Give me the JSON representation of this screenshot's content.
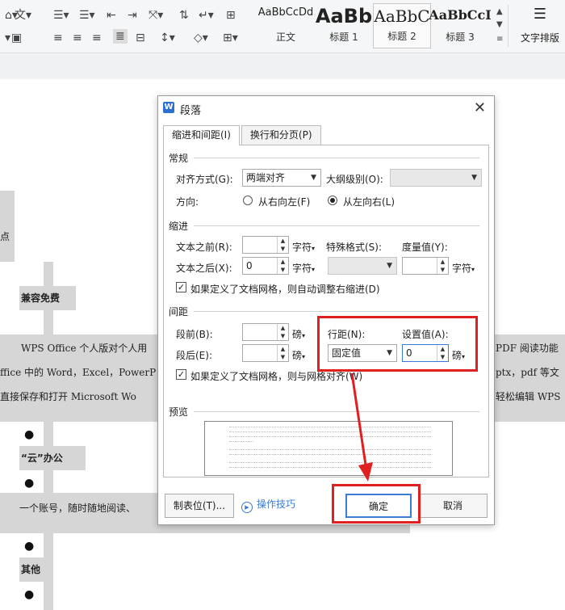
{
  "ribbon": {
    "styles": [
      {
        "sample": "AaBbCcDd",
        "name": "正文"
      },
      {
        "sample": "AaBb",
        "name": "标题 1"
      },
      {
        "sample": "AaBbC",
        "name": "标题 2"
      },
      {
        "sample": "AaBbCcI",
        "name": "标题 3"
      }
    ],
    "layout_label": "文字排版"
  },
  "document": {
    "frag_dian": "点",
    "heading1": "兼容免费",
    "para1": "WPS Office 个人版对个人用",
    "para1_right": "PDF 阅读功能",
    "para2": "ffice 中的 Word，Excel，PowerP",
    "para2_right": "ptx，pdf 等文",
    "para3": "直接保存和打开  Microsoft Wo",
    "para3_right": "轻松编辑 WPS",
    "heading2": "“云”办公",
    "para4": "一个账号，随时随地阅读、",
    "heading3": "其他"
  },
  "dialog": {
    "title": "段落",
    "tabs": [
      "缩进和间距(I)",
      "换行和分页(P)"
    ],
    "general": {
      "section": "常规",
      "align_label": "对齐方式(G):",
      "align_value": "两端对齐",
      "outline_label": "大纲级别(O):",
      "outline_value": "",
      "direction_label": "方向:",
      "rtl_label": "从右向左(F)",
      "ltr_label": "从左向右(L)"
    },
    "indent": {
      "section": "缩进",
      "before_label": "文本之前(R):",
      "before_value": "",
      "after_label": "文本之后(X):",
      "after_value": "0",
      "unit": "字符",
      "special_label": "特殊格式(S):",
      "special_value": "",
      "measure_label": "度量值(Y):",
      "measure_value": "",
      "grid_check": "如果定义了文档网格，则自动调整右缩进(D)"
    },
    "spacing": {
      "section": "间距",
      "before_label": "段前(B):",
      "before_value": "",
      "after_label": "段后(E):",
      "after_value": "",
      "unit": "磅",
      "line_label": "行距(N):",
      "line_value": "固定值",
      "set_label": "设置值(A):",
      "set_value": "0",
      "grid_check": "如果定义了文档网格，则与网格对齐(W)"
    },
    "preview_label": "预览",
    "tab_stops_button": "制表位(T)...",
    "tips_link": "操作技巧",
    "ok_button": "确定",
    "cancel_button": "取消"
  },
  "colors": {
    "annotation_red": "#e02020",
    "accent_blue": "#3a7bd5"
  }
}
